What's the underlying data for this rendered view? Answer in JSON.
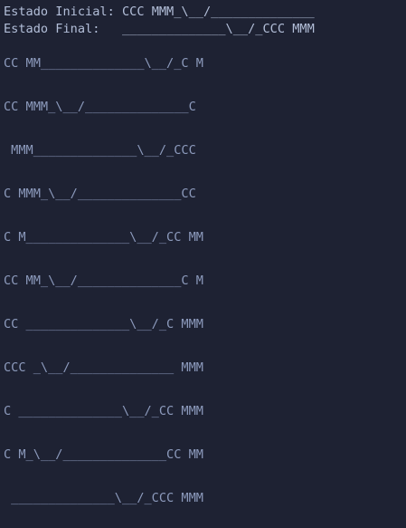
{
  "header": {
    "initial_label": "Estado Inicial:",
    "initial_value": "CCC MMM_\\__/______________",
    "final_label": "Estado Final:",
    "final_value": "______________\\__/_CCC MMM"
  },
  "states": [
    "CC MM______________\\__/_C M",
    "CC MMM_\\__/______________C",
    " MMM______________\\__/_CCC",
    "C MMM_\\__/______________CC",
    "C M______________\\__/_CC MM",
    "CC MM_\\__/______________C M",
    "CC ______________\\__/_C MMM",
    "CCC _\\__/______________ MMM",
    "C ______________\\__/_CC MMM",
    "C M_\\__/______________CC MM",
    " ______________\\__/_CCC MMM"
  ]
}
